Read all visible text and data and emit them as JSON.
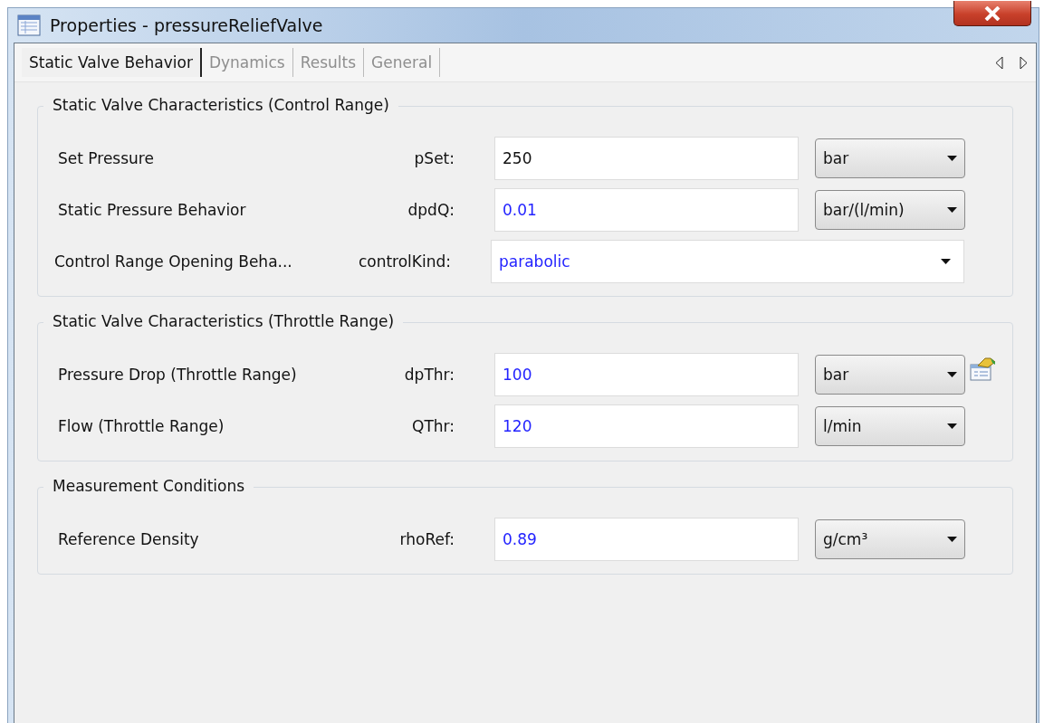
{
  "window": {
    "title": "Properties - pressureReliefValve"
  },
  "tabs": [
    {
      "label": "Static Valve Behavior",
      "selected": true
    },
    {
      "label": "Dynamics",
      "selected": false
    },
    {
      "label": "Results",
      "selected": false
    },
    {
      "label": "General",
      "selected": false
    }
  ],
  "groups": [
    {
      "title": "Static Valve Characteristics (Control Range)",
      "rows": [
        {
          "kind": "field",
          "label": "Set Pressure",
          "param": "pSet:",
          "value": "250",
          "modified": false,
          "unit": "bar",
          "editor_button": false
        },
        {
          "kind": "field",
          "label": "Static Pressure Behavior",
          "param": "dpdQ:",
          "value": "0.01",
          "modified": true,
          "unit": "bar/(l/min)",
          "editor_button": false
        },
        {
          "kind": "combo",
          "label": "Control Range Opening Beha...",
          "param": "controlKind:",
          "value": "parabolic",
          "modified": true
        }
      ]
    },
    {
      "title": "Static Valve Characteristics (Throttle Range)",
      "rows": [
        {
          "kind": "field",
          "label": "Pressure Drop (Throttle Range)",
          "param": "dpThr:",
          "value": "100",
          "modified": true,
          "unit": "bar",
          "editor_button": true
        },
        {
          "kind": "field",
          "label": "Flow (Throttle Range)",
          "param": "QThr:",
          "value": "120",
          "modified": true,
          "unit": "l/min",
          "editor_button": false
        }
      ]
    },
    {
      "title": "Measurement Conditions",
      "rows": [
        {
          "kind": "field",
          "label": "Reference Density",
          "param": "rhoRef:",
          "value": "0.89",
          "modified": true,
          "unit": "g/cm³",
          "editor_button": false
        }
      ]
    }
  ]
}
